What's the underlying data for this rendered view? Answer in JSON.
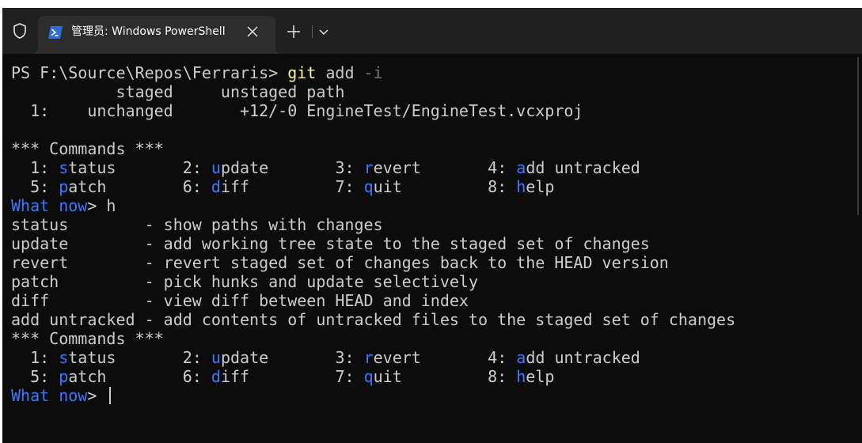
{
  "window": {
    "tab_title": "管理员: Windows PowerShell",
    "icons": {
      "shield": "shield-icon",
      "tab": "powershell-icon",
      "close": "close-icon",
      "new_tab": "plus-icon",
      "dropdown": "chevron-down-icon"
    }
  },
  "colors": {
    "background": "#0c0c0c",
    "foreground": "#cccccc",
    "prompt_blue": "#3b78ff",
    "help_red": "#e74856",
    "command_yellow": "#f9f1a5"
  },
  "terminal": {
    "prompt": "PS F:\\Source\\Repos\\Ferraris> ",
    "command": "git",
    "args": " add ",
    "flag": "-i",
    "status_header": "           staged     unstaged path",
    "status_row": "  1:    unchanged       +12/-0 EngineTest/EngineTest.vcxproj",
    "commands_header": "*** Commands ***",
    "menu": [
      {
        "num": "  1: ",
        "hot": "s",
        "rest": "tatus",
        "pad": "       "
      },
      {
        "num": "2: ",
        "hot": "u",
        "rest": "pdate",
        "pad": "       "
      },
      {
        "num": "3: ",
        "hot": "r",
        "rest": "evert",
        "pad": "       "
      },
      {
        "num": "4: ",
        "hot": "a",
        "rest": "dd untracked",
        "pad": ""
      },
      {
        "num": "  5: ",
        "hot": "p",
        "rest": "atch",
        "pad": "        "
      },
      {
        "num": "6: ",
        "hot": "d",
        "rest": "iff",
        "pad": "         "
      },
      {
        "num": "7: ",
        "hot": "q",
        "rest": "uit",
        "pad": "         "
      },
      {
        "num": "8: ",
        "hot": "h",
        "rest": "elp",
        "pad": ""
      }
    ],
    "what_now": "What now",
    "prompt_suffix": "> ",
    "input_h": "h",
    "help_lines": [
      "status        - show paths with changes",
      "update        - add working tree state to the staged set of changes",
      "revert        - revert staged set of changes back to the HEAD version",
      "patch         - pick hunks and update selectively",
      "diff          - view diff between HEAD and index",
      "add untracked - add contents of untracked files to the staged set of changes"
    ]
  }
}
